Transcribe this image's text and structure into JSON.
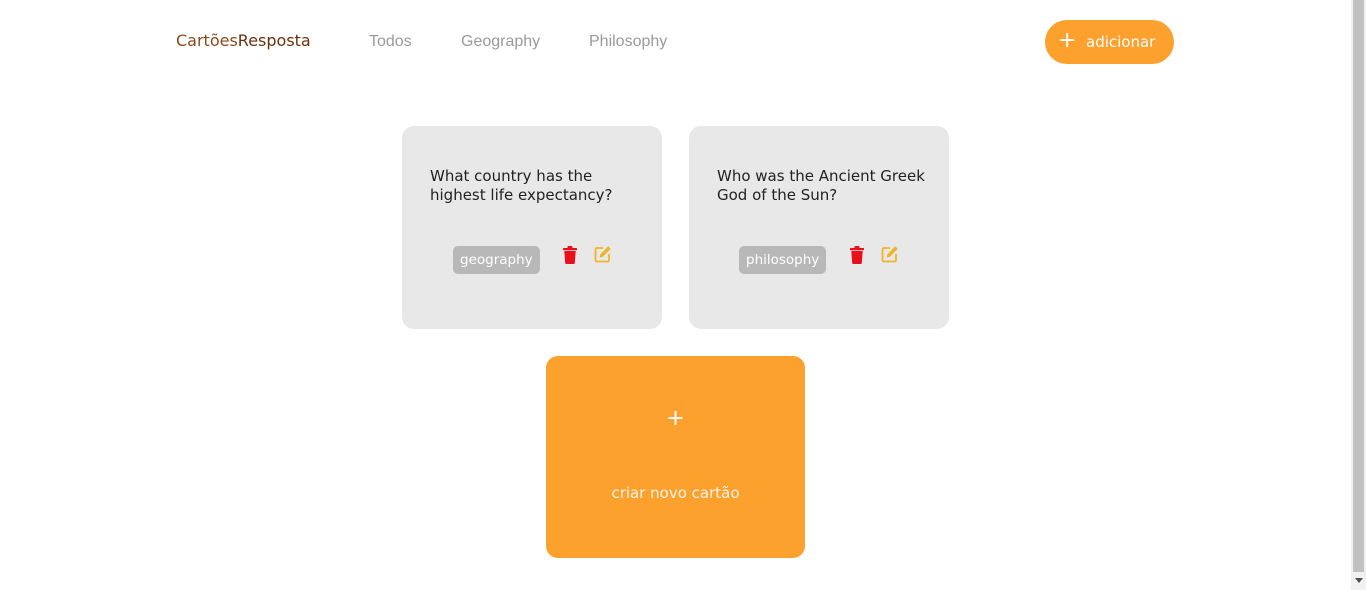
{
  "header": {
    "logo_part1": "Cartões",
    "logo_part2": "Resposta",
    "nav": [
      "Todos",
      "Geography",
      "Philosophy"
    ],
    "add_button": {
      "icon": "+",
      "label": "adicionar"
    }
  },
  "cards": [
    {
      "question": "What country has the highest life expectancy?",
      "tag": "geography",
      "delete_icon": "trash-icon",
      "edit_icon": "edit-icon"
    },
    {
      "question": "Who was the Ancient Greek God of the Sun?",
      "tag": "philosophy",
      "delete_icon": "trash-icon",
      "edit_icon": "edit-icon"
    }
  ],
  "new_card": {
    "icon": "+",
    "label": "criar novo cartão"
  },
  "colors": {
    "accent": "#fca12e",
    "card_bg": "#e8e8e8",
    "tag_bg": "#b8b8b8",
    "delete": "#e8101a",
    "edit": "#f0b429",
    "logo": "#8a4a1c"
  }
}
